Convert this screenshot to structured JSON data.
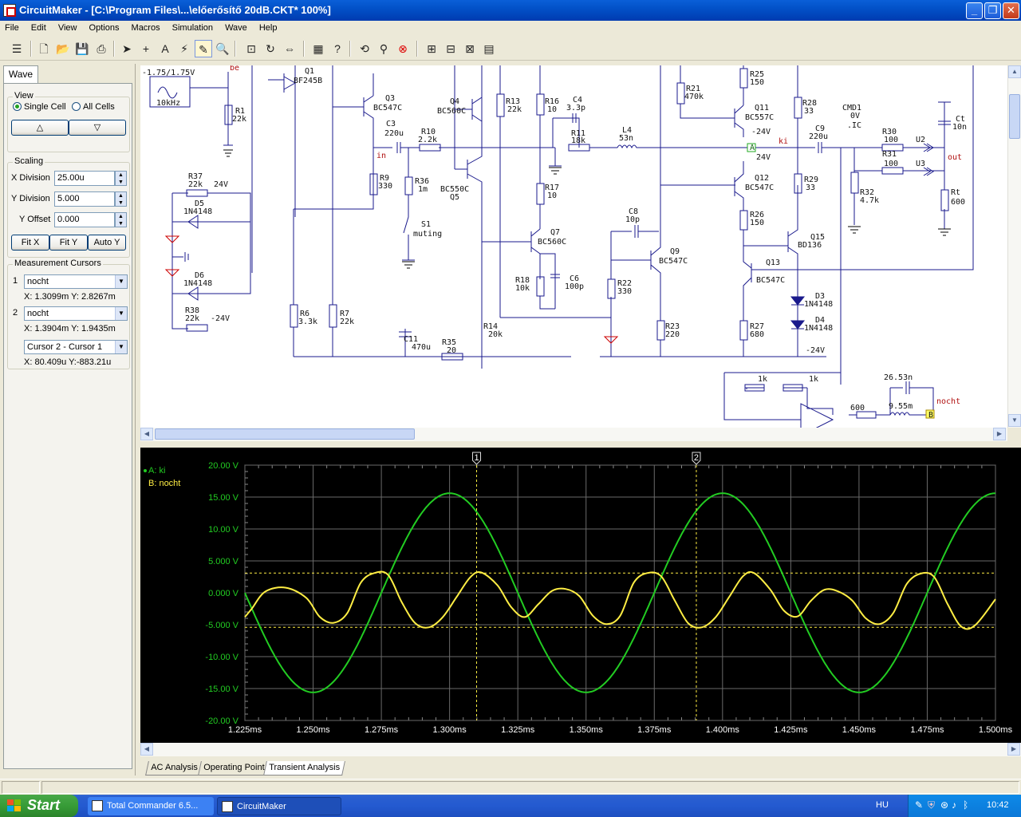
{
  "window": {
    "title": "CircuitMaker - [C:\\Program Files\\...\\előerősítő 20dB.CKT* 100%]",
    "minimize": "_",
    "restore": "❐",
    "close": "✕"
  },
  "menu": [
    "File",
    "Edit",
    "View",
    "Options",
    "Macros",
    "Simulation",
    "Wave",
    "Help"
  ],
  "left_panel": {
    "tab": "Wave",
    "view": {
      "title": "View",
      "single_cell": "Single Cell",
      "all_cells": "All Cells",
      "selected": "single_cell",
      "up": "△",
      "down": "▽"
    },
    "scaling": {
      "title": "Scaling",
      "x_division_label": "X Division",
      "x_division": "25.00u",
      "y_division_label": "Y Division",
      "y_division": "5.000",
      "y_offset_label": "Y Offset",
      "y_offset": "0.000",
      "fit_x": "Fit X",
      "fit_y": "Fit Y",
      "auto_y": "Auto Y"
    },
    "cursors": {
      "title": "Measurement Cursors",
      "c1_num": "1",
      "c1_signal": "nocht",
      "c1_readout": "X: 1.3099m  Y: 2.8267m",
      "c2_num": "2",
      "c2_signal": "nocht",
      "c2_readout": "X: 1.3904m  Y: 1.9435m",
      "diff_select": "Cursor 2 - Cursor 1",
      "diff_readout": "X: 80.409u  Y:-883.21u"
    }
  },
  "schematic": {
    "labels": {
      "gen": "-1.75/1.75V",
      "gen_freq": "10kHz",
      "be": "be",
      "in": "in",
      "ki": "ki",
      "out": "out",
      "nocht": "nocht",
      "q1": "Q1",
      "q1t": "BF245B",
      "q3": "Q3",
      "q3t": "BC547C",
      "q4": "Q4",
      "q4t": "BC560C",
      "q5": "Q5",
      "q5t": "BC550C",
      "q7": "Q7",
      "q7t": "BC560C",
      "q9": "Q9",
      "q9t": "BC547C",
      "q11": "Q11",
      "q11t": "BC557C",
      "q12": "Q12",
      "q12t": "BC547C",
      "q13": "Q13",
      "q13t": "BC547C",
      "q15": "Q15",
      "q15t": "BD136",
      "r1": "R1",
      "r1v": "22k",
      "r6": "R6",
      "r6v": "3.3k",
      "r7": "R7",
      "r7v": "22k",
      "r9": "R9",
      "r9v": "330",
      "r10": "R10",
      "r10v": "2.2k",
      "r11": "R11",
      "r11v": "18k",
      "r13": "R13",
      "r13v": "22k",
      "r14": "R14",
      "r14v": "20k",
      "r16": "R16",
      "r16v": "10",
      "r17": "R17",
      "r17v": "10",
      "r18": "R18",
      "r18v": "10k",
      "r21": "R21",
      "r21v": "470k",
      "r22": "R22",
      "r22v": "330",
      "r23": "R23",
      "r23v": "220",
      "r25": "R25",
      "r25v": "150",
      "r26": "R26",
      "r26v": "150",
      "r27": "R27",
      "r27v": "680",
      "r28": "R28",
      "r28v": "33",
      "r29": "R29",
      "r29v": "33",
      "r30": "R30",
      "r30v": "100",
      "r31": "R31",
      "r31v": "100",
      "r32": "R32",
      "r32v": "4.7k",
      "r35": "R35",
      "r35v": "20",
      "r36": "R36",
      "r36v": "1m",
      "r37": "R37",
      "r37v": "22k",
      "r38": "R38",
      "r38v": "22k",
      "rt": "Rt",
      "rtv": "600",
      "c3": "C3",
      "c3v": "220u",
      "c4": "C4",
      "c4v": "3.3p",
      "c6": "C6",
      "c6v": "100p",
      "c8": "C8",
      "c8v": "10p",
      "c9": "C9",
      "c9v": "220u",
      "c11": "C11",
      "c11v": "470u",
      "ct": "Ct",
      "ctv": "10n",
      "l4": "L4",
      "l4v": "53n",
      "s1": "S1",
      "s1t": "muting",
      "d3": "D3",
      "d3t": "1N4148",
      "d4": "D4",
      "d4t": "1N4148",
      "d5": "D5",
      "d5t": "1N4148",
      "d6": "D6",
      "d6t": "1N4148",
      "cmd1": "CMD1",
      "cmd1v": "0V",
      "ic": ".IC",
      "u2": "U2",
      "u3": "U3",
      "p24a": "24V",
      "p24b": "24V",
      "m24a": "-24V",
      "m24b": "-24V",
      "m24c": "-24V",
      "f1k_a": "1k",
      "f1k_b": "1k",
      "f600": "600",
      "f26n": "26.53n",
      "f955": "9.55m",
      "probeA": "A",
      "probeB": "B"
    }
  },
  "waveform": {
    "legend": [
      {
        "label": "A: ki",
        "color": "#22cc22"
      },
      {
        "label": "B: nocht",
        "color": "#ffee44"
      }
    ],
    "cursor1": "1",
    "cursor2": "2"
  },
  "chart_data": {
    "type": "line",
    "title": "",
    "xlabel": "",
    "ylabel": "",
    "x_ticks": [
      "1.225ms",
      "1.250ms",
      "1.275ms",
      "1.300ms",
      "1.325ms",
      "1.350ms",
      "1.375ms",
      "1.400ms",
      "1.425ms",
      "1.450ms",
      "1.475ms",
      "1.500ms"
    ],
    "y_ticks": [
      "20.00 V",
      "15.00 V",
      "10.00 V",
      "5.000 V",
      "0.000 V",
      "-5.000 V",
      "-10.00 V",
      "-15.00 V",
      "-20.00 V"
    ],
    "xlim": [
      1.225,
      1.5
    ],
    "ylim": [
      -20,
      20
    ],
    "grid": true,
    "cursors_x": [
      1.3099,
      1.3904
    ],
    "cursor_levels_y": [
      3.1,
      -5.4
    ],
    "series": [
      {
        "name": "A: ki",
        "color": "#22cc22",
        "x": [
          1.225,
          1.2375,
          1.25,
          1.2625,
          1.275,
          1.2875,
          1.3,
          1.3125,
          1.325,
          1.3375,
          1.35,
          1.3625,
          1.375,
          1.3875,
          1.4,
          1.4125,
          1.425,
          1.4375,
          1.45,
          1.4625,
          1.475,
          1.4875,
          1.5
        ],
        "y": [
          0,
          -11,
          -15.6,
          -11,
          0,
          11,
          15.6,
          11,
          0,
          -11,
          -15.6,
          -11,
          0,
          11,
          15.6,
          11,
          0,
          -11,
          -15.6,
          -11,
          0,
          11,
          15.6
        ]
      },
      {
        "name": "B: nocht",
        "color": "#ffee44",
        "x": [
          1.225,
          1.2275,
          1.2325,
          1.24,
          1.2475,
          1.2525,
          1.2575,
          1.2625,
          1.2675,
          1.2725,
          1.2775,
          1.2825,
          1.2875,
          1.2925,
          1.2975,
          1.3025,
          1.3075,
          1.3115,
          1.3175,
          1.3225,
          1.3275,
          1.3325,
          1.3375,
          1.3425,
          1.3475,
          1.3525,
          1.3575,
          1.3625,
          1.3675,
          1.3725,
          1.3775,
          1.3825,
          1.3875,
          1.3925,
          1.3975,
          1.4025,
          1.4075,
          1.4115,
          1.4175,
          1.4225,
          1.4275,
          1.4325,
          1.4375,
          1.4425,
          1.4475,
          1.4525,
          1.4575,
          1.4625,
          1.4675,
          1.4725,
          1.4775,
          1.4825,
          1.4875,
          1.4925,
          1.5
        ],
        "y": [
          -3.8,
          -2.5,
          0.2,
          0.8,
          -0.8,
          -3.8,
          -4.7,
          -3.2,
          1.6,
          3.1,
          2.8,
          -1.5,
          -4.8,
          -5.4,
          -3.8,
          -0.7,
          2.4,
          3.2,
          1.2,
          -2.2,
          -3.8,
          -1.8,
          0.3,
          0.6,
          -0.5,
          -3.6,
          -4.9,
          -3.6,
          1.6,
          3.1,
          2.6,
          -1.2,
          -4.8,
          -5.4,
          -3.8,
          -0.6,
          2.6,
          3.1,
          0.5,
          -2.8,
          -3.7,
          -1.2,
          0.5,
          0.2,
          -1.2,
          -4.0,
          -4.9,
          -3.2,
          1.4,
          3.0,
          2.5,
          -1.8,
          -5.3,
          -5.1,
          -1.0
        ]
      }
    ]
  },
  "analysis_tabs": [
    "AC Analysis",
    "Operating Point",
    "Transient Analysis"
  ],
  "taskbar": {
    "start": "Start",
    "tasks": [
      "Total Commander 6.5...",
      "CircuitMaker"
    ],
    "lang": "HU",
    "clock": "10:42"
  }
}
